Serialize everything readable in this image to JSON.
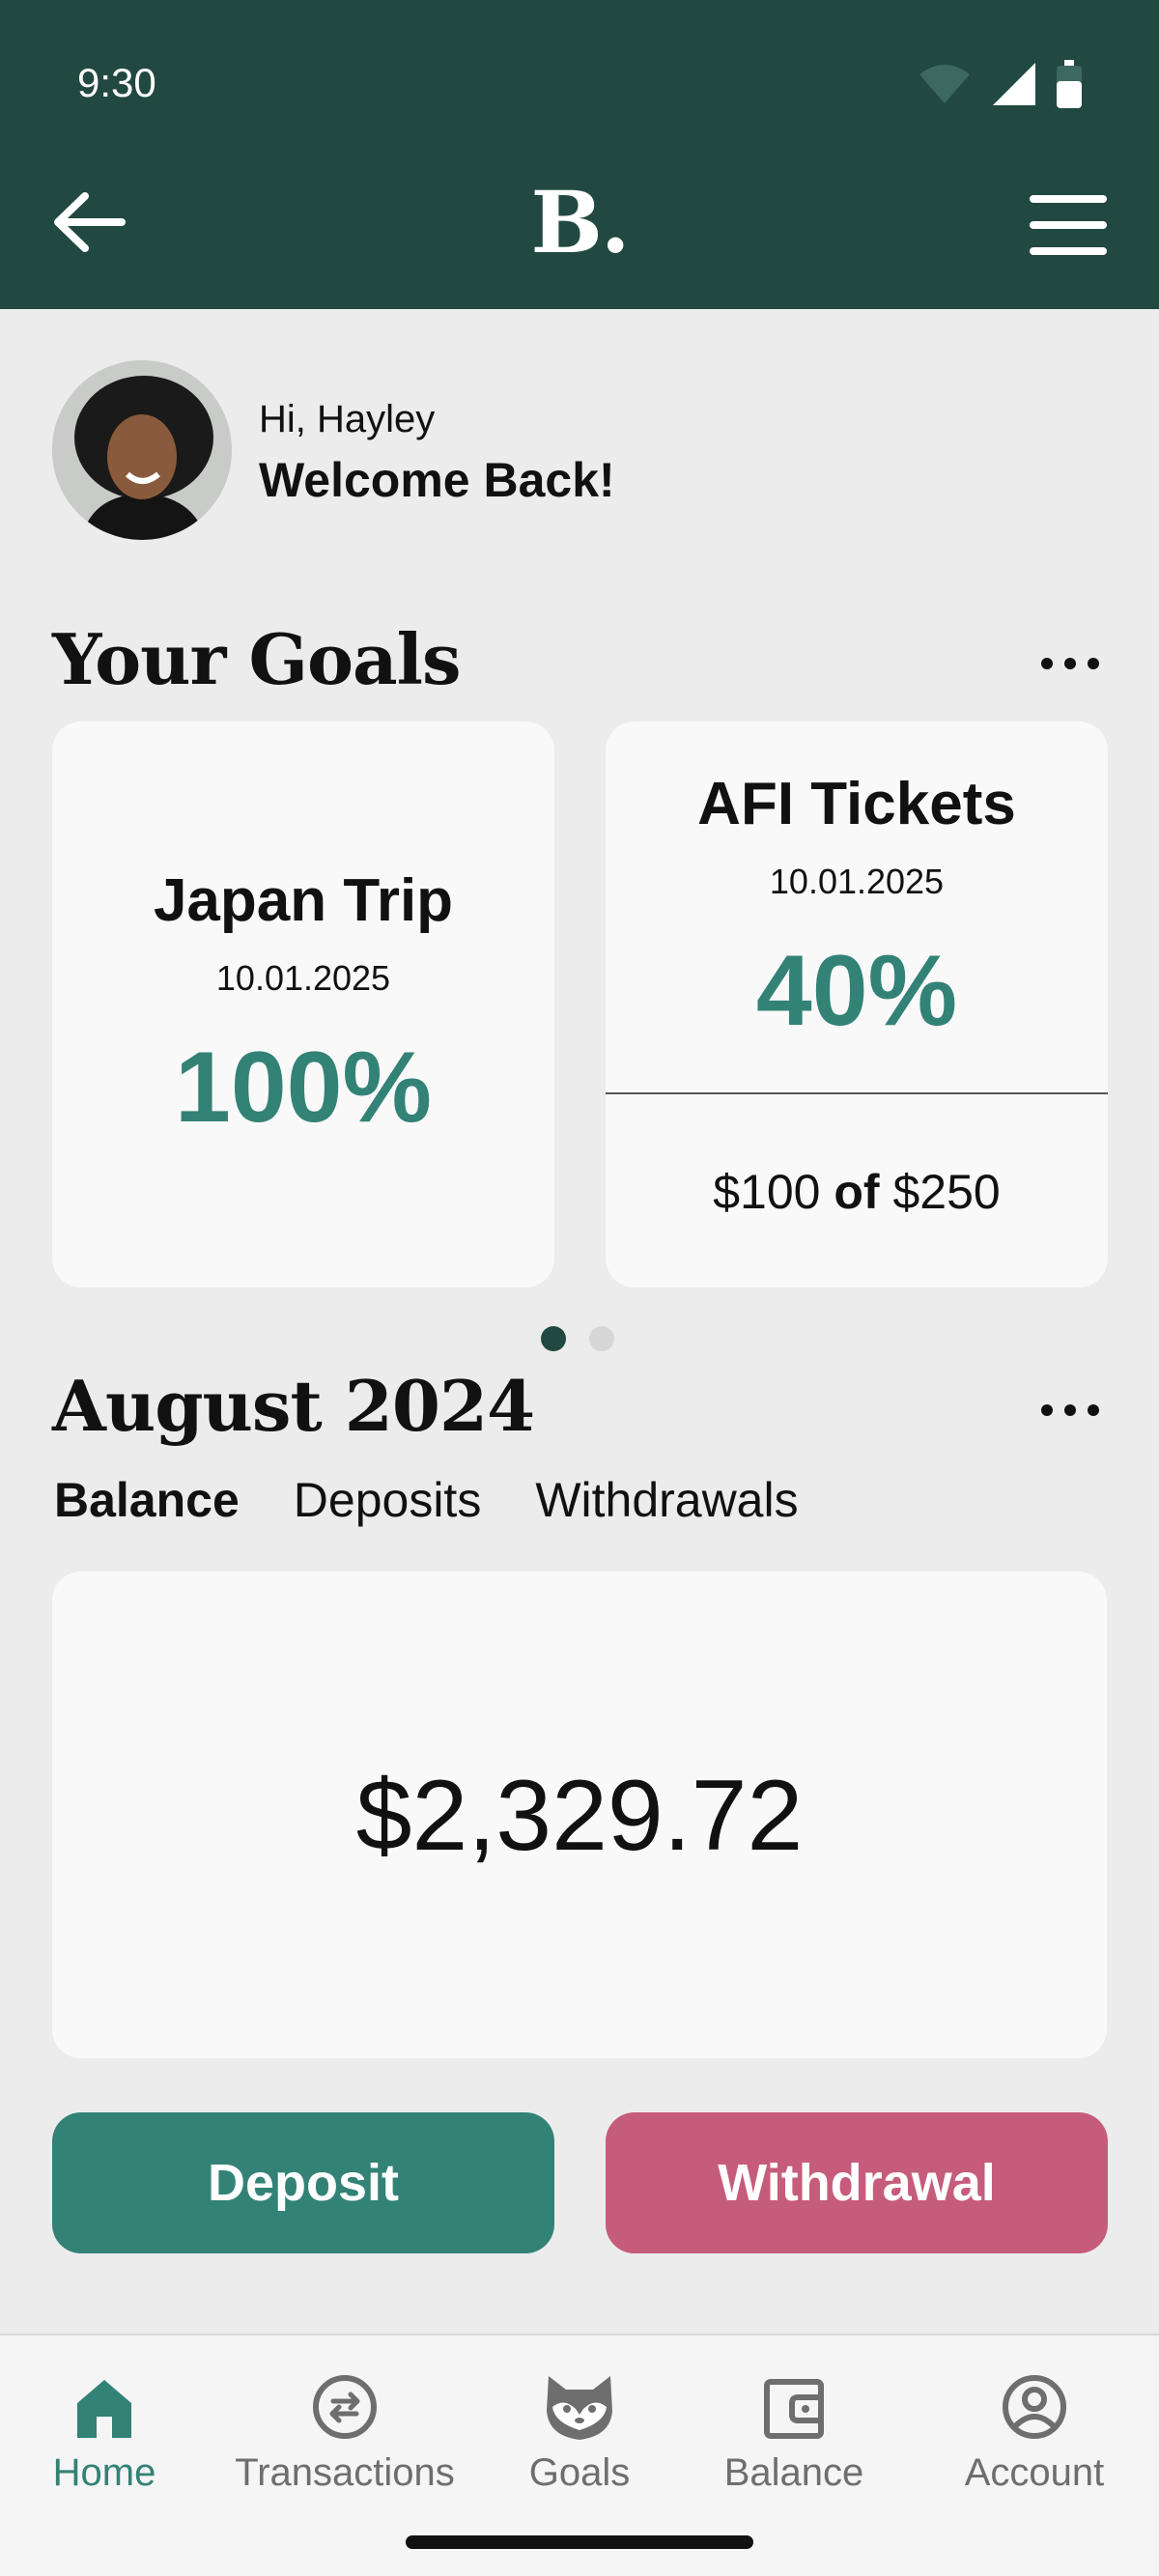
{
  "status_bar": {
    "time": "9:30",
    "icons": [
      "wifi-icon",
      "signal-icon",
      "battery-icon"
    ]
  },
  "header": {
    "logo": "B.",
    "icons": [
      "back-arrow-icon",
      "hamburger-menu-icon"
    ]
  },
  "greeting": {
    "hello": "Hi, Hayley",
    "welcome": "Welcome Back!"
  },
  "goals": {
    "title": "Your Goals",
    "cards": [
      {
        "name": "Japan Trip",
        "date": "10.01.2025",
        "percent": "100%"
      },
      {
        "name": "AFI Tickets",
        "date": "10.01.2025",
        "percent": "40%",
        "progress": {
          "amount": "$100",
          "of": "of",
          "target": "$250"
        }
      }
    ],
    "carousel": {
      "pages": 2,
      "active_page": 1
    }
  },
  "month": {
    "title": "August 2024",
    "tabs": [
      {
        "label": "Balance",
        "active": true
      },
      {
        "label": "Deposits",
        "active": false
      },
      {
        "label": "Withdrawals",
        "active": false
      }
    ],
    "balance": "$2,329.72"
  },
  "actions": {
    "deposit": "Deposit",
    "withdrawal": "Withdrawal"
  },
  "bottom_nav": {
    "items": [
      {
        "label": "Home",
        "icon": "home-icon",
        "active": true
      },
      {
        "label": "Transactions",
        "icon": "transfer-arrows-icon",
        "active": false
      },
      {
        "label": "Goals",
        "icon": "raccoon-icon",
        "active": false
      },
      {
        "label": "Balance",
        "icon": "wallet-icon",
        "active": false
      },
      {
        "label": "Account",
        "icon": "user-circle-icon",
        "active": false
      }
    ]
  },
  "colors": {
    "header_bg": "#214941",
    "page_bg": "#ececec",
    "card_bg": "#f9f9f9",
    "accent_green": "#338276",
    "withdrawal_pink": "#c65c7b",
    "dot_active": "#214941",
    "dot_inactive": "#d6d6d6"
  }
}
